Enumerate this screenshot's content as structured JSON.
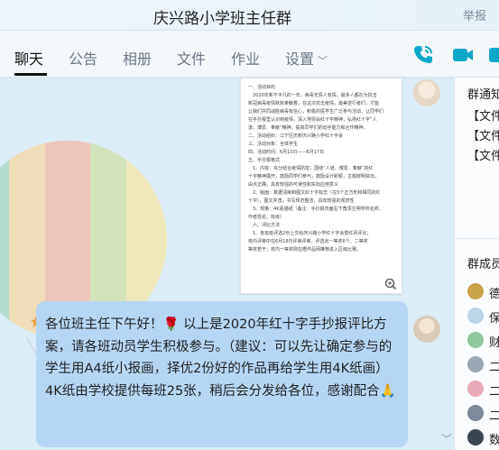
{
  "window": {
    "title": "庆兴路小学班主任群",
    "report_label": "举报"
  },
  "tabs": [
    {
      "label": "聊天",
      "active": true
    },
    {
      "label": "公告"
    },
    {
      "label": "相册"
    },
    {
      "label": "文件"
    },
    {
      "label": "作业"
    },
    {
      "label": "设置"
    }
  ],
  "toolbar_icons": [
    "phone-icon",
    "video-call-icon",
    "more-icon"
  ],
  "document_preview": {
    "lines": [
      "一、活动目的",
      "　2020年新不平凡的一年，病毒无情人有情，最多人都在为抗击",
      "新冠病毒疫情默默奉献着，在这次抗击疫情，最美逆行者们，才能",
      "让我们共同战胜病毒有信心，积极的医学生广泛参与活动，让同学们",
      "在手抄报里认识到疫情，深入地领会红十字精神，弘扬红十字“人",
      "道、博爱、奉献”精神，提高同学们的动手能力和合作精神。",
      "二、活动组织：江宁区庆新庆兴路小学红十字会",
      "三、活动对象：全体学生",
      "四、活动时间：6月10日——6月17日",
      "五、手抄报格式",
      "　1、内容：充分结合疫情防控，围绕“人道、博爱、奉献”的红",
      "十字精神展开，鼓励同学们参与，鼓励设计新颖，主题鲜明突出，",
      "由点正确，具有较强的可读性和实际应用意义",
      "　2、版面：数据清晰和图文红十字标志（在5个正方形和相同的红",
      "十字），图文并茂，书写规范整洁，具有较强的观赏性",
      "　3、规格：4K素描纸（备注：手抄报背面右下角须注明学校名称、",
      "作者姓名、班级）",
      "　六、评比方法",
      "　1、各班级评选2份上交给庆兴路小学红十字会暨红风评比；",
      "校内评审中在6月18日评审评审，评选出一等奖6个、二等奖",
      "等奖若干；校内一等奖则在晒作品网推荐进入区级比赛。"
    ]
  },
  "message": {
    "text": "各位班主任下午好！🌹 以上是2020年红十字手抄报评比方案，请各班动员学生积极参与。（建议：可以先让确定参与的学生用A4纸小报画，择优2份好的作品再给学生用4K纸画）4K纸由学校提供每班25张，稍后会分发给各位，感谢配合🙏"
  },
  "right_panel": {
    "notice_title": "群通知",
    "files": [
      "【文件】",
      "【文件】",
      "【文件】"
    ],
    "members_title": "群成员",
    "members": [
      {
        "name": "德",
        "color": "#c9a34a"
      },
      {
        "name": "保",
        "color": "#bcd6e8"
      },
      {
        "name": "财",
        "color": "#8fc79a"
      },
      {
        "name": "二",
        "color": "#9aa8b5"
      },
      {
        "name": "二",
        "color": "#e7a9b7"
      },
      {
        "name": "二",
        "color": "#7d8a99"
      },
      {
        "name": "数",
        "color": "#3a4552"
      }
    ]
  },
  "colors": {
    "accent": "#0aa7c9",
    "bubble": "#b7d6f4",
    "chat_bg": "#dcecf6"
  }
}
